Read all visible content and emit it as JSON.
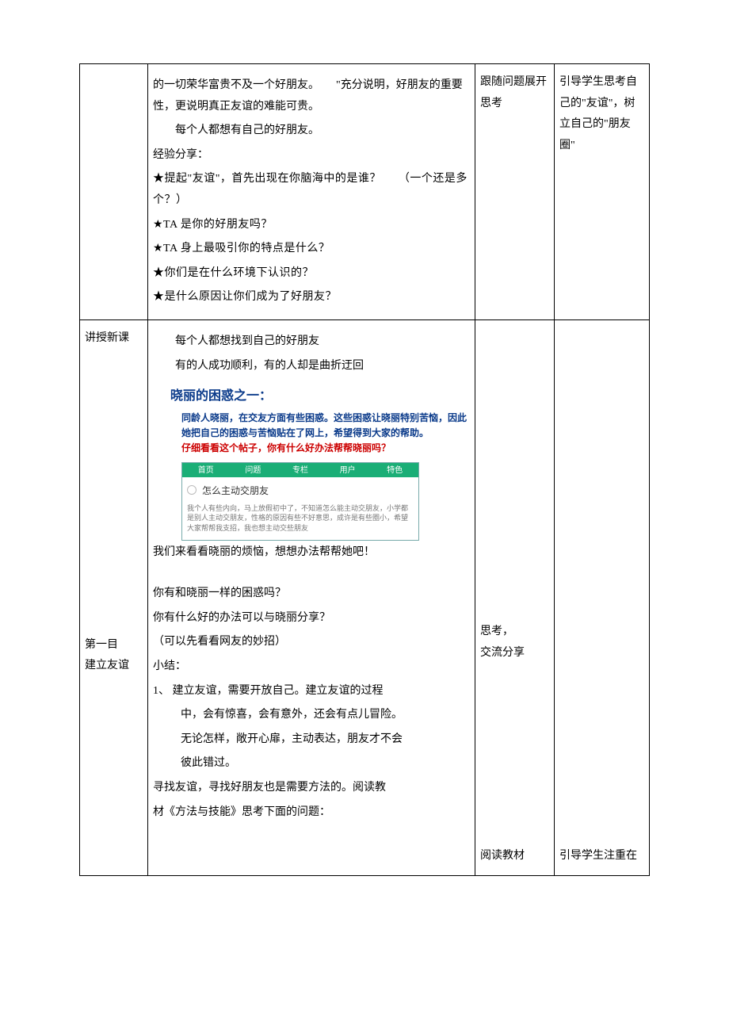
{
  "row1": {
    "col1": "",
    "col2": {
      "p1": "的一切荣华富贵不及一个好朋友。　　\"充分说明，好朋友的重要性，更说明真正友谊的难能可贵。",
      "p2": "每个人都想有自己的好朋友。",
      "p3": "经验分享：",
      "q1": "★提起\"友谊\"，首先出现在你脑海中的是谁？　　（一个还是多个？）",
      "q2": "★TA 是你的好朋友吗？",
      "q3": "★TA 身上最吸引你的特点是什么？",
      "q4": "★你们是在什么环境下认识的？",
      "q5": "★是什么原因让你们成为了好朋友？"
    },
    "col3": "跟随问题展开思考",
    "col4": "引导学生思考自己的\"友谊\"，树立自己的\"朋友圈\""
  },
  "row2": {
    "col1a": "讲授新课",
    "col1b": "第一目",
    "col1c": "建立友谊",
    "col2": {
      "p1": "每个人都想找到自己的好朋友",
      "p2": "有的人成功顺利，有的人却是曲折迂回",
      "story_title": "晓丽的困惑之一：",
      "story_body_1": "同龄人晓丽，在交友方面有些困惑。这些困惑让晓丽特别苦恼，因此她把自己的困惑与苦恼贴在了网上，希望得到大家的帮助。",
      "story_body_2": "仔细看看这个帖子，你有什么好办法帮帮晓丽吗？",
      "forum_tabs": [
        "首页",
        "问题",
        "专栏",
        "用户",
        "特色"
      ],
      "forum_thread_title": "怎么主动交朋友",
      "forum_thread_body": "我个人有些内向，马上放假初中了，不知道怎么能主动交朋友，小学都是别人主动交朋友，性格的原因有些不好意思，成许是有些圈小，希望大家帮帮我支招，我也想主动交些朋友",
      "after_box": "我们来看看晓丽的烦恼，想想办法帮帮她吧！",
      "blank": "",
      "q1": "你有和晓丽一样的困惑吗？",
      "q2": "你有什么好的办法可以与晓丽分享？",
      "q3": "（可以先看看网友的妙招）",
      "s_title": "小结：",
      "s1_num": "1、 建立友谊，需要开放自己。建立友谊的过程",
      "s1_a": "中，会有惊喜，会有意外，还会有点儿冒险。",
      "s1_b": "无论怎样，敞开心扉，主动表达，朋友才不会",
      "s1_c": "彼此错过。",
      "p_end1": "寻找友谊，寻找好朋友也是需要方法的。阅读教",
      "p_end2": "材《方法与技能》思考下面的问题："
    },
    "col3a": "思考，",
    "col3b": "交流分享",
    "col3c": "阅读教材",
    "col4": "引导学生注重在"
  }
}
